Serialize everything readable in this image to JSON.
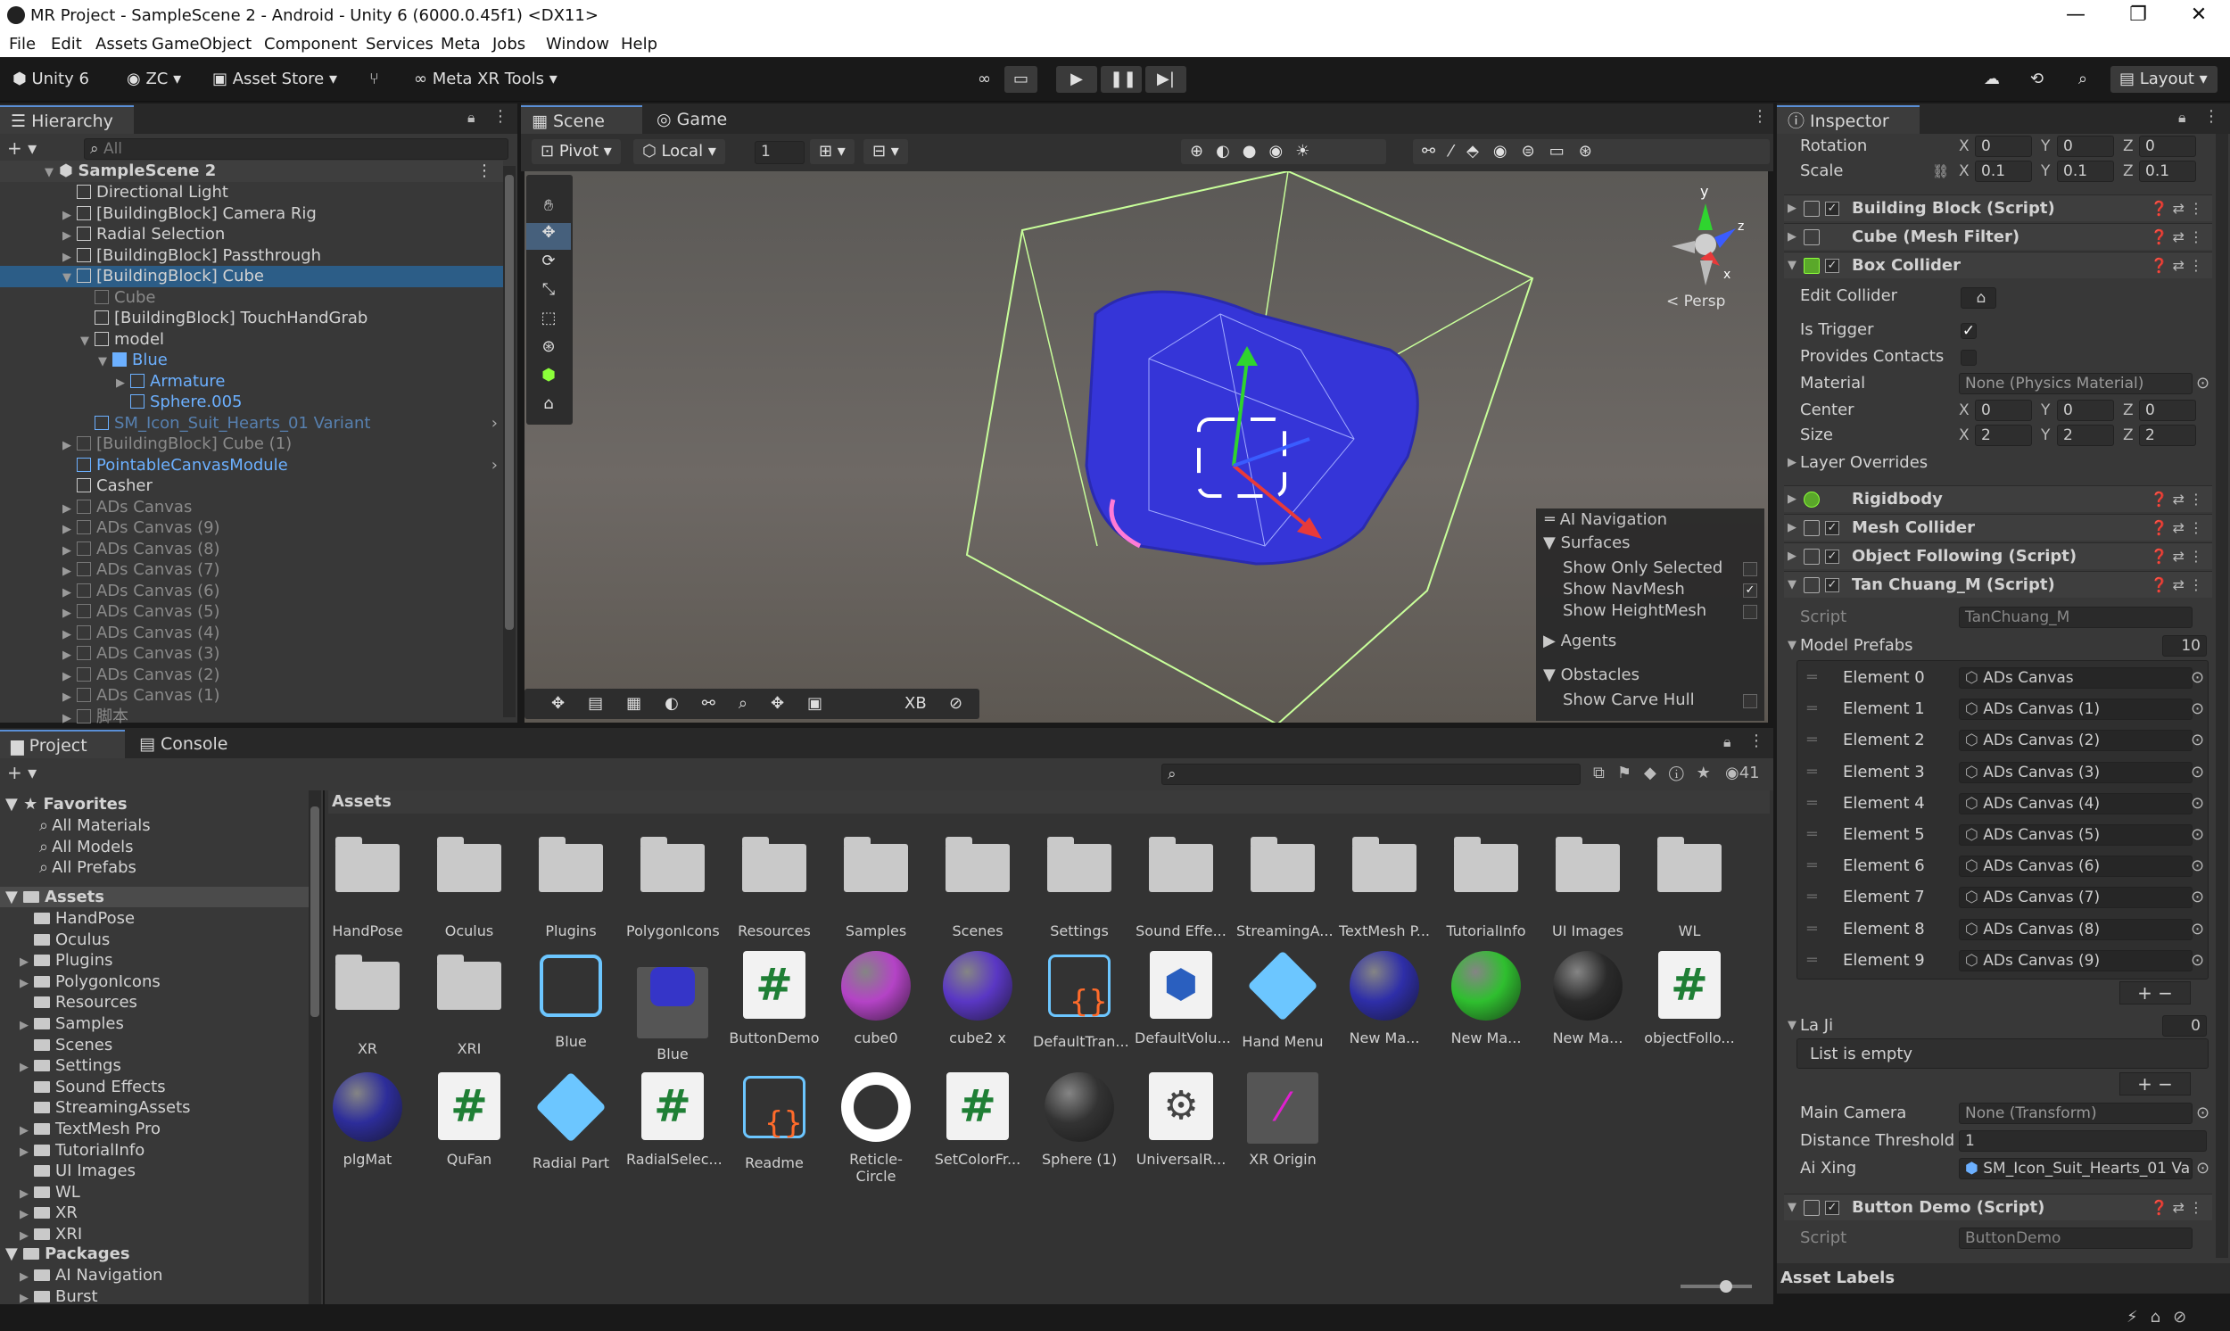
{
  "window": {
    "title": "MR Project - SampleScene 2 - Android - Unity 6 (6000.0.45f1) <DX11>",
    "minimize": "—",
    "maximize": "❐",
    "close": "✕"
  },
  "menu": [
    "File",
    "Edit",
    "Assets",
    "GameObject",
    "Component",
    "Services",
    "Meta",
    "Jobs",
    "Window",
    "Help"
  ],
  "toolbar": {
    "unity": "Unity 6",
    "account": "ZC",
    "asset_store": "Asset Store",
    "meta_xr": "Meta XR Tools",
    "layout": "Layout"
  },
  "hierarchy": {
    "tab": "Hierarchy",
    "search_placeholder": "All",
    "scene": "SampleScene 2",
    "items": [
      {
        "label": "Directional Light",
        "indent": 1,
        "arrow": "",
        "style": ""
      },
      {
        "label": "[BuildingBlock] Camera Rig",
        "indent": 1,
        "arrow": "▶",
        "style": ""
      },
      {
        "label": "Radial Selection",
        "indent": 1,
        "arrow": "▶",
        "style": ""
      },
      {
        "label": "[BuildingBlock] Passthrough",
        "indent": 1,
        "arrow": "▶",
        "style": ""
      },
      {
        "label": "[BuildingBlock] Cube",
        "indent": 1,
        "arrow": "▼",
        "style": "sel"
      },
      {
        "label": "Cube",
        "indent": 2,
        "arrow": "",
        "style": "dim"
      },
      {
        "label": "[BuildingBlock] TouchHandGrab",
        "indent": 2,
        "arrow": "",
        "style": ""
      },
      {
        "label": "model",
        "indent": 2,
        "arrow": "▼",
        "style": ""
      },
      {
        "label": "Blue",
        "indent": 3,
        "arrow": "▼",
        "style": "blue"
      },
      {
        "label": "Armature",
        "indent": 4,
        "arrow": "▶",
        "style": "blue"
      },
      {
        "label": "Sphere.005",
        "indent": 4,
        "arrow": "",
        "style": "blue"
      },
      {
        "label": "SM_Icon_Suit_Hearts_01 Variant",
        "indent": 2,
        "arrow": "",
        "style": "blue dimblue"
      },
      {
        "label": "[BuildingBlock] Cube (1)",
        "indent": 1,
        "arrow": "▶",
        "style": "dim"
      },
      {
        "label": "PointableCanvasModule",
        "indent": 1,
        "arrow": "",
        "style": "blue"
      },
      {
        "label": "Casher",
        "indent": 1,
        "arrow": "",
        "style": ""
      },
      {
        "label": "ADs Canvas",
        "indent": 1,
        "arrow": "▶",
        "style": "dim"
      },
      {
        "label": "ADs Canvas (9)",
        "indent": 1,
        "arrow": "▶",
        "style": "dim"
      },
      {
        "label": "ADs Canvas (8)",
        "indent": 1,
        "arrow": "▶",
        "style": "dim"
      },
      {
        "label": "ADs Canvas (7)",
        "indent": 1,
        "arrow": "▶",
        "style": "dim"
      },
      {
        "label": "ADs Canvas (6)",
        "indent": 1,
        "arrow": "▶",
        "style": "dim"
      },
      {
        "label": "ADs Canvas (5)",
        "indent": 1,
        "arrow": "▶",
        "style": "dim"
      },
      {
        "label": "ADs Canvas (4)",
        "indent": 1,
        "arrow": "▶",
        "style": "dim"
      },
      {
        "label": "ADs Canvas (3)",
        "indent": 1,
        "arrow": "▶",
        "style": "dim"
      },
      {
        "label": "ADs Canvas (2)",
        "indent": 1,
        "arrow": "▶",
        "style": "dim"
      },
      {
        "label": "ADs Canvas (1)",
        "indent": 1,
        "arrow": "▶",
        "style": "dim"
      },
      {
        "label": "脚本",
        "indent": 1,
        "arrow": "▶",
        "style": "dim"
      }
    ]
  },
  "scene_view": {
    "tab_scene": "Scene",
    "tab_game": "Game",
    "pivot": "Pivot",
    "local": "Local",
    "grid_value": "1",
    "persp": "< Persp",
    "overlay_xb": "XB"
  },
  "ai_navigation": {
    "title": "AI Navigation",
    "surfaces": "Surfaces",
    "show_only_selected": "Show Only Selected",
    "show_navmesh": "Show NavMesh",
    "show_heightmesh": "Show HeightMesh",
    "agents": "Agents",
    "obstacles": "Obstacles",
    "show_carve_hull": "Show Carve Hull"
  },
  "project": {
    "tab_project": "Project",
    "tab_console": "Console",
    "breadcrumb": "Assets",
    "count": "41",
    "favorites": {
      "label": "Favorites",
      "items": [
        "All Materials",
        "All Models",
        "All Prefabs"
      ]
    },
    "assets_label": "Assets",
    "tree": [
      {
        "label": "HandPose",
        "arrow": ""
      },
      {
        "label": "Oculus",
        "arrow": ""
      },
      {
        "label": "Plugins",
        "arrow": "▶"
      },
      {
        "label": "PolygonIcons",
        "arrow": "▶"
      },
      {
        "label": "Resources",
        "arrow": ""
      },
      {
        "label": "Samples",
        "arrow": "▶"
      },
      {
        "label": "Scenes",
        "arrow": ""
      },
      {
        "label": "Settings",
        "arrow": "▶"
      },
      {
        "label": "Sound Effects",
        "arrow": ""
      },
      {
        "label": "StreamingAssets",
        "arrow": ""
      },
      {
        "label": "TextMesh Pro",
        "arrow": "▶"
      },
      {
        "label": "TutorialInfo",
        "arrow": "▶"
      },
      {
        "label": "UI Images",
        "arrow": ""
      },
      {
        "label": "WL",
        "arrow": "▶"
      },
      {
        "label": "XR",
        "arrow": "▶"
      },
      {
        "label": "XRI",
        "arrow": "▶"
      }
    ],
    "packages_label": "Packages",
    "packages": [
      {
        "label": "AI Navigation",
        "arrow": "▶"
      },
      {
        "label": "Burst",
        "arrow": "▶"
      }
    ],
    "grid_row1": [
      "HandPose",
      "Oculus",
      "Plugins",
      "PolygonIcons",
      "Resources",
      "Samples",
      "Scenes",
      "Settings",
      "Sound Effe...",
      "StreamingA...",
      "TextMesh P...",
      "TutorialInfo",
      "UI Images",
      "WL"
    ],
    "grid_row2": [
      "XR",
      "XRI",
      "Blue",
      "Blue",
      "ButtonDemo",
      "cube0",
      "cube2 x",
      "DefaultTran...",
      "DefaultVolu...",
      "Hand Menu",
      "New Ma...",
      "New Ma...",
      "New Ma...",
      "objectFollo..."
    ],
    "grid_row3": [
      "plgMat",
      "QuFan",
      "Radial Part",
      "RadialSelec...",
      "Readme",
      "Reticle-Circle",
      "SetColorFr...",
      "Sphere (1)",
      "UniversalR...",
      "XR Origin"
    ]
  },
  "inspector": {
    "tab": "Inspector",
    "rotation": {
      "label": "Rotation",
      "x": "0",
      "y": "0",
      "z": "0"
    },
    "scale": {
      "label": "Scale",
      "x": "0.1",
      "y": "0.1",
      "z": "0.1"
    },
    "building_block": "Building Block (Script)",
    "mesh_filter": "Cube (Mesh Filter)",
    "box_collider": "Box Collider",
    "edit_collider": "Edit Collider",
    "is_trigger": "Is Trigger",
    "provides_contacts": "Provides Contacts",
    "material": {
      "label": "Material",
      "value": "None (Physics Material)"
    },
    "center": {
      "label": "Center",
      "x": "0",
      "y": "0",
      "z": "0"
    },
    "size": {
      "label": "Size",
      "x": "2",
      "y": "2",
      "z": "2"
    },
    "layer_overrides": "Layer Overrides",
    "rigidbody": "Rigidbody",
    "mesh_collider": "Mesh Collider",
    "object_following": "Object Following (Script)",
    "tan_chuang": "Tan Chuang_M (Script)",
    "script_label": "Script",
    "script_value": "TanChuang_M",
    "model_prefabs": {
      "label": "Model Prefabs",
      "count": "10"
    },
    "elements": [
      {
        "label": "Element 0",
        "value": "ADs Canvas"
      },
      {
        "label": "Element 1",
        "value": "ADs Canvas (1)"
      },
      {
        "label": "Element 2",
        "value": "ADs Canvas (2)"
      },
      {
        "label": "Element 3",
        "value": "ADs Canvas (3)"
      },
      {
        "label": "Element 4",
        "value": "ADs Canvas (4)"
      },
      {
        "label": "Element 5",
        "value": "ADs Canvas (5)"
      },
      {
        "label": "Element 6",
        "value": "ADs Canvas (6)"
      },
      {
        "label": "Element 7",
        "value": "ADs Canvas (7)"
      },
      {
        "label": "Element 8",
        "value": "ADs Canvas (8)"
      },
      {
        "label": "Element 9",
        "value": "ADs Canvas (9)"
      }
    ],
    "la_ji": {
      "label": "La Ji",
      "count": "0",
      "empty": "List is empty"
    },
    "main_camera": {
      "label": "Main Camera",
      "value": "None (Transform)"
    },
    "distance_threshold": {
      "label": "Distance Threshold",
      "value": "1"
    },
    "ai_xing": {
      "label": "Ai Xing",
      "value": "SM_Icon_Suit_Hearts_01 Va"
    },
    "button_demo": "Button Demo (Script)",
    "button_demo_script": "ButtonDemo",
    "asset_labels": "Asset Labels"
  }
}
